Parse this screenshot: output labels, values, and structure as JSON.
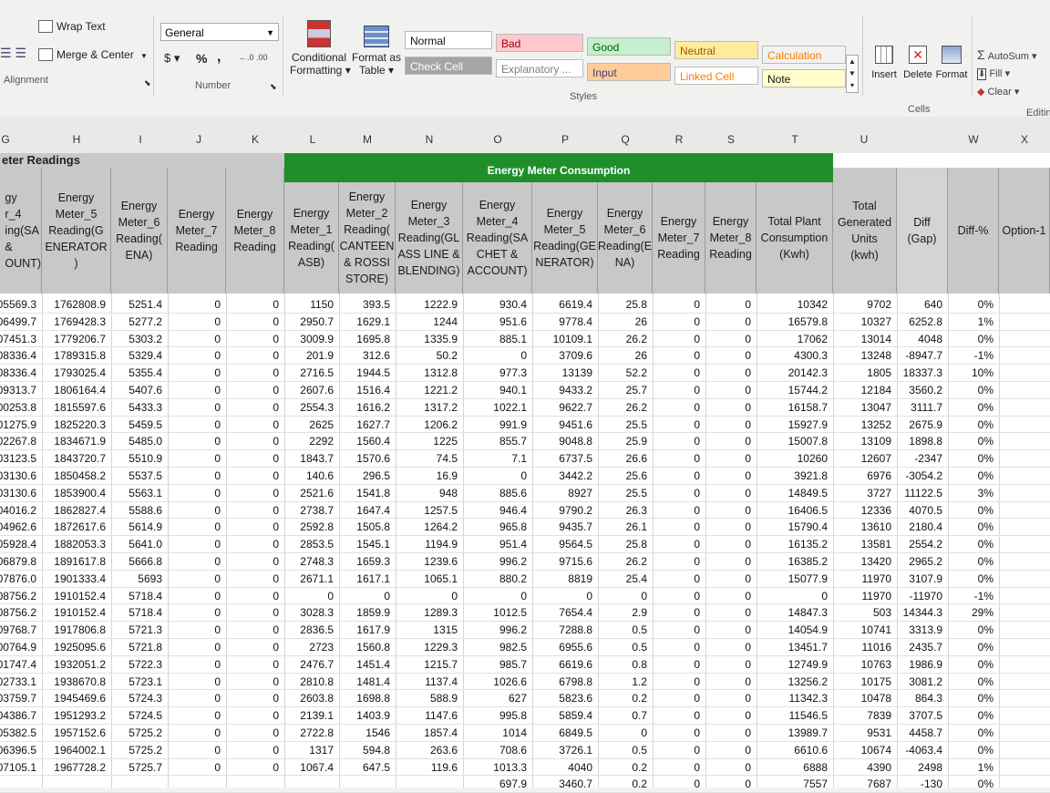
{
  "ribbon": {
    "alignment": {
      "wrap_text": "Wrap Text",
      "merge_center": "Merge & Center",
      "label": "Alignment"
    },
    "number": {
      "format_value": "General",
      "currency_symbol": "$",
      "percent_symbol": "%",
      "comma_symbol": ",",
      "increase_decimal": "←.0 .00",
      "decrease_decimal": ".00 →.0",
      "label": "Number"
    },
    "styles": {
      "conditional_formatting_1": "Conditional",
      "conditional_formatting_2": "Formatting",
      "format_as_table_1": "Format as",
      "format_as_table_2": "Table",
      "cells": [
        {
          "label": "Normal",
          "bg": "#ffffff",
          "fg": "#111111"
        },
        {
          "label": "Bad",
          "bg": "#ffc7ce",
          "fg": "#9c0006"
        },
        {
          "label": "Good",
          "bg": "#c6efce",
          "fg": "#006100"
        },
        {
          "label": "Neutral",
          "bg": "#ffeb9c",
          "fg": "#9c5700"
        },
        {
          "label": "Calculation",
          "bg": "#f2f2f2",
          "fg": "#fa7d00"
        },
        {
          "label": "Check Cell",
          "bg": "#a5a5a5",
          "fg": "#ffffff"
        },
        {
          "label": "Explanatory ...",
          "bg": "#ffffff",
          "fg": "#7f7f7f"
        },
        {
          "label": "Input",
          "bg": "#ffcc99",
          "fg": "#3f3f76"
        },
        {
          "label": "Linked Cell",
          "bg": "#ffffff",
          "fg": "#fa7d00"
        },
        {
          "label": "Note",
          "bg": "#ffffcc",
          "fg": "#111111"
        }
      ],
      "label": "Styles"
    },
    "cells_group": {
      "insert": "Insert",
      "delete": "Delete",
      "format": "Format",
      "label": "Cells"
    },
    "editing": {
      "autosum": "AutoSum",
      "fill": "Fill",
      "clear": "Clear",
      "label": "Editin"
    }
  },
  "columns": [
    "G",
    "H",
    "I",
    "J",
    "K",
    "L",
    "M",
    "N",
    "O",
    "P",
    "Q",
    "R",
    "S",
    "T",
    "U",
    "V",
    "W",
    "X"
  ],
  "sheet": {
    "meter_readings_title": "eter Readings",
    "consumption_title": "Energy Meter Consumption",
    "headers": [
      "gy\nr_4\ning(SA\n&\nOUNT)",
      "Energy\nMeter_5\nReading(G\nENERATOR\n)",
      "Energy\nMeter_6\nReading(\nENA)",
      "Energy\nMeter_7\nReading",
      "Energy\nMeter_8\nReading",
      "Energy\nMeter_1\nReading(\nASB)",
      "Energy\nMeter_2\nReading(\nCANTEEN\n& ROSSI\nSTORE)",
      "Energy\nMeter_3\nReading(GL\nASS LINE &\nBLENDING)",
      "Energy\nMeter_4\nReading(SA\nCHET &\nACCOUNT)",
      "Energy\nMeter_5\nReading(GE\nNERATOR)",
      "Energy\nMeter_6\nReading(E\nNA)",
      "Energy\nMeter_7\nReading",
      "Energy\nMeter_8\nReading",
      "Total Plant\nConsumption\n(Kwh)",
      "Total\nGenerated\nUnits\n(kwh)",
      "Diff\n(Gap)",
      "Diff-%",
      "Option-1"
    ],
    "rows": [
      [
        "05569.3",
        "1762808.9",
        "5251.4",
        "0",
        "0",
        "1150",
        "393.5",
        "1222.9",
        "930.4",
        "6619.4",
        "25.8",
        "0",
        "0",
        "10342",
        "9702",
        "640",
        "0%"
      ],
      [
        "06499.7",
        "1769428.3",
        "5277.2",
        "0",
        "0",
        "2950.7",
        "1629.1",
        "1244",
        "951.6",
        "9778.4",
        "26",
        "0",
        "0",
        "16579.8",
        "10327",
        "6252.8",
        "1%"
      ],
      [
        "07451.3",
        "1779206.7",
        "5303.2",
        "0",
        "0",
        "3009.9",
        "1695.8",
        "1335.9",
        "885.1",
        "10109.1",
        "26.2",
        "0",
        "0",
        "17062",
        "13014",
        "4048",
        "0%"
      ],
      [
        "08336.4",
        "1789315.8",
        "5329.4",
        "0",
        "0",
        "201.9",
        "312.6",
        "50.2",
        "0",
        "3709.6",
        "26",
        "0",
        "0",
        "4300.3",
        "13248",
        "-8947.7",
        "-1%"
      ],
      [
        "08336.4",
        "1793025.4",
        "5355.4",
        "0",
        "0",
        "2716.5",
        "1944.5",
        "1312.8",
        "977.3",
        "13139",
        "52.2",
        "0",
        "0",
        "20142.3",
        "1805",
        "18337.3",
        "10%"
      ],
      [
        "09313.7",
        "1806164.4",
        "5407.6",
        "0",
        "0",
        "2607.6",
        "1516.4",
        "1221.2",
        "940.1",
        "9433.2",
        "25.7",
        "0",
        "0",
        "15744.2",
        "12184",
        "3560.2",
        "0%"
      ],
      [
        "00253.8",
        "1815597.6",
        "5433.3",
        "0",
        "0",
        "2554.3",
        "1616.2",
        "1317.2",
        "1022.1",
        "9622.7",
        "26.2",
        "0",
        "0",
        "16158.7",
        "13047",
        "3111.7",
        "0%"
      ],
      [
        "01275.9",
        "1825220.3",
        "5459.5",
        "0",
        "0",
        "2625",
        "1627.7",
        "1206.2",
        "991.9",
        "9451.6",
        "25.5",
        "0",
        "0",
        "15927.9",
        "13252",
        "2675.9",
        "0%"
      ],
      [
        "02267.8",
        "1834671.9",
        "5485.0",
        "0",
        "0",
        "2292",
        "1560.4",
        "1225",
        "855.7",
        "9048.8",
        "25.9",
        "0",
        "0",
        "15007.8",
        "13109",
        "1898.8",
        "0%"
      ],
      [
        "03123.5",
        "1843720.7",
        "5510.9",
        "0",
        "0",
        "1843.7",
        "1570.6",
        "74.5",
        "7.1",
        "6737.5",
        "26.6",
        "0",
        "0",
        "10260",
        "12607",
        "-2347",
        "0%"
      ],
      [
        "03130.6",
        "1850458.2",
        "5537.5",
        "0",
        "0",
        "140.6",
        "296.5",
        "16.9",
        "0",
        "3442.2",
        "25.6",
        "0",
        "0",
        "3921.8",
        "6976",
        "-3054.2",
        "0%"
      ],
      [
        "03130.6",
        "1853900.4",
        "5563.1",
        "0",
        "0",
        "2521.6",
        "1541.8",
        "948",
        "885.6",
        "8927",
        "25.5",
        "0",
        "0",
        "14849.5",
        "3727",
        "11122.5",
        "3%"
      ],
      [
        "04016.2",
        "1862827.4",
        "5588.6",
        "0",
        "0",
        "2738.7",
        "1647.4",
        "1257.5",
        "946.4",
        "9790.2",
        "26.3",
        "0",
        "0",
        "16406.5",
        "12336",
        "4070.5",
        "0%"
      ],
      [
        "04962.6",
        "1872617.6",
        "5614.9",
        "0",
        "0",
        "2592.8",
        "1505.8",
        "1264.2",
        "965.8",
        "9435.7",
        "26.1",
        "0",
        "0",
        "15790.4",
        "13610",
        "2180.4",
        "0%"
      ],
      [
        "05928.4",
        "1882053.3",
        "5641.0",
        "0",
        "0",
        "2853.5",
        "1545.1",
        "1194.9",
        "951.4",
        "9564.5",
        "25.8",
        "0",
        "0",
        "16135.2",
        "13581",
        "2554.2",
        "0%"
      ],
      [
        "06879.8",
        "1891617.8",
        "5666.8",
        "0",
        "0",
        "2748.3",
        "1659.3",
        "1239.6",
        "996.2",
        "9715.6",
        "26.2",
        "0",
        "0",
        "16385.2",
        "13420",
        "2965.2",
        "0%"
      ],
      [
        "07876.0",
        "1901333.4",
        "5693",
        "0",
        "0",
        "2671.1",
        "1617.1",
        "1065.1",
        "880.2",
        "8819",
        "25.4",
        "0",
        "0",
        "15077.9",
        "11970",
        "3107.9",
        "0%"
      ],
      [
        "08756.2",
        "1910152.4",
        "5718.4",
        "0",
        "0",
        "0",
        "0",
        "0",
        "0",
        "0",
        "0",
        "0",
        "0",
        "0",
        "11970",
        "-11970",
        "-1%"
      ],
      [
        "08756.2",
        "1910152.4",
        "5718.4",
        "0",
        "0",
        "3028.3",
        "1859.9",
        "1289.3",
        "1012.5",
        "7654.4",
        "2.9",
        "0",
        "0",
        "14847.3",
        "503",
        "14344.3",
        "29%"
      ],
      [
        "09768.7",
        "1917806.8",
        "5721.3",
        "0",
        "0",
        "2836.5",
        "1617.9",
        "1315",
        "996.2",
        "7288.8",
        "0.5",
        "0",
        "0",
        "14054.9",
        "10741",
        "3313.9",
        "0%"
      ],
      [
        "00764.9",
        "1925095.6",
        "5721.8",
        "0",
        "0",
        "2723",
        "1560.8",
        "1229.3",
        "982.5",
        "6955.6",
        "0.5",
        "0",
        "0",
        "13451.7",
        "11016",
        "2435.7",
        "0%"
      ],
      [
        "01747.4",
        "1932051.2",
        "5722.3",
        "0",
        "0",
        "2476.7",
        "1451.4",
        "1215.7",
        "985.7",
        "6619.6",
        "0.8",
        "0",
        "0",
        "12749.9",
        "10763",
        "1986.9",
        "0%"
      ],
      [
        "02733.1",
        "1938670.8",
        "5723.1",
        "0",
        "0",
        "2810.8",
        "1481.4",
        "1137.4",
        "1026.6",
        "6798.8",
        "1.2",
        "0",
        "0",
        "13256.2",
        "10175",
        "3081.2",
        "0%"
      ],
      [
        "03759.7",
        "1945469.6",
        "5724.3",
        "0",
        "0",
        "2603.8",
        "1698.8",
        "588.9",
        "627",
        "5823.6",
        "0.2",
        "0",
        "0",
        "11342.3",
        "10478",
        "864.3",
        "0%"
      ],
      [
        "04386.7",
        "1951293.2",
        "5724.5",
        "0",
        "0",
        "2139.1",
        "1403.9",
        "1147.6",
        "995.8",
        "5859.4",
        "0.7",
        "0",
        "0",
        "11546.5",
        "7839",
        "3707.5",
        "0%"
      ],
      [
        "05382.5",
        "1957152.6",
        "5725.2",
        "0",
        "0",
        "2722.8",
        "1546",
        "1857.4",
        "1014",
        "6849.5",
        "0",
        "0",
        "0",
        "13989.7",
        "9531",
        "4458.7",
        "0%"
      ],
      [
        "06396.5",
        "1964002.1",
        "5725.2",
        "0",
        "0",
        "1317",
        "594.8",
        "263.6",
        "708.6",
        "3726.1",
        "0.5",
        "0",
        "0",
        "6610.6",
        "10674",
        "-4063.4",
        "0%"
      ],
      [
        "07105.1",
        "1967728.2",
        "5725.7",
        "0",
        "0",
        "1067.4",
        "647.5",
        "119.6",
        "1013.3",
        "4040",
        "0.2",
        "0",
        "0",
        "6888",
        "4390",
        "2498",
        "1%"
      ],
      [
        "",
        "",
        "",
        "",
        "",
        "",
        "",
        "",
        "697.9",
        "3460.7",
        "0.2",
        "0",
        "0",
        "7557",
        "7687",
        "-130",
        "0%"
      ]
    ]
  }
}
